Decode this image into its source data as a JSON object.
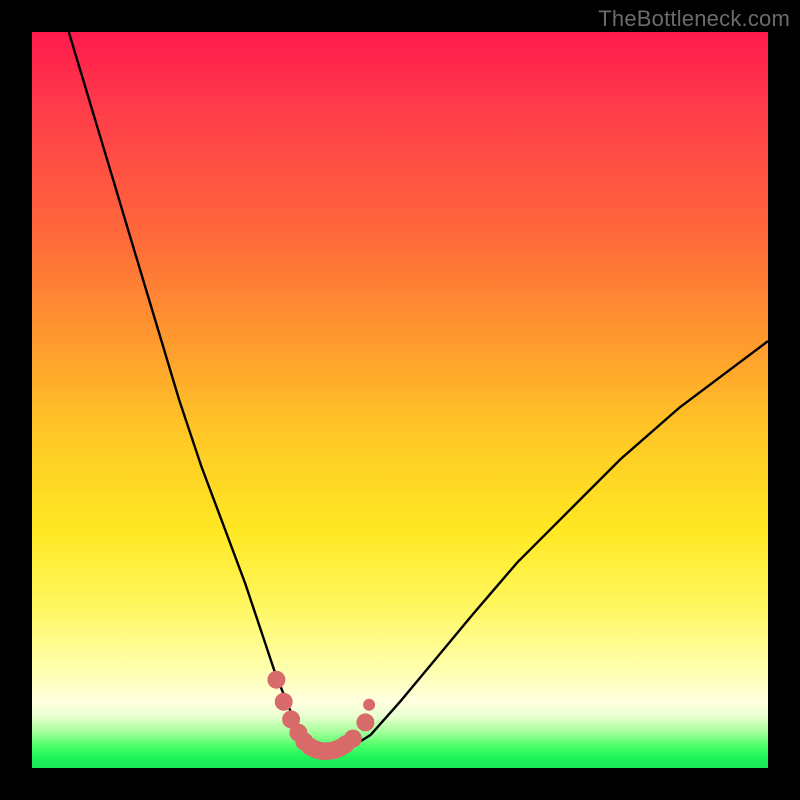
{
  "watermark": "TheBottleneck.com",
  "colors": {
    "frame": "#000000",
    "curve": "#000000",
    "marker": "#d96a6a",
    "marker_stroke": "#d96a6a"
  },
  "chart_data": {
    "type": "line",
    "title": "",
    "xlabel": "",
    "ylabel": "",
    "xlim": [
      0,
      100
    ],
    "ylim": [
      0,
      100
    ],
    "grid": false,
    "series": [
      {
        "name": "bottleneck-curve",
        "x": [
          5,
          8,
          11,
          14,
          17,
          20,
          23,
          26,
          29,
          31,
          33,
          35,
          36.5,
          38,
          39.5,
          41,
          43,
          46,
          50,
          55,
          60,
          66,
          72,
          80,
          88,
          96,
          100
        ],
        "y": [
          100,
          90,
          80,
          70,
          60,
          50,
          41,
          33,
          25,
          19,
          13,
          8,
          5,
          3.2,
          2.4,
          2.2,
          2.6,
          4.5,
          9,
          15,
          21,
          28,
          34,
          42,
          49,
          55,
          58
        ]
      }
    ],
    "markers": {
      "name": "highlight-dots",
      "x": [
        33.2,
        34.2,
        35.2,
        36.2,
        37.0,
        37.8,
        38.6,
        39.4,
        40.2,
        41.0,
        41.8,
        42.6,
        43.6,
        45.3
      ],
      "y": [
        12.0,
        9.0,
        6.6,
        4.8,
        3.6,
        2.9,
        2.5,
        2.3,
        2.3,
        2.4,
        2.7,
        3.2,
        4.0,
        6.2
      ],
      "r": 9,
      "outlier": {
        "x": 45.8,
        "y": 8.6,
        "r": 6
      }
    }
  }
}
